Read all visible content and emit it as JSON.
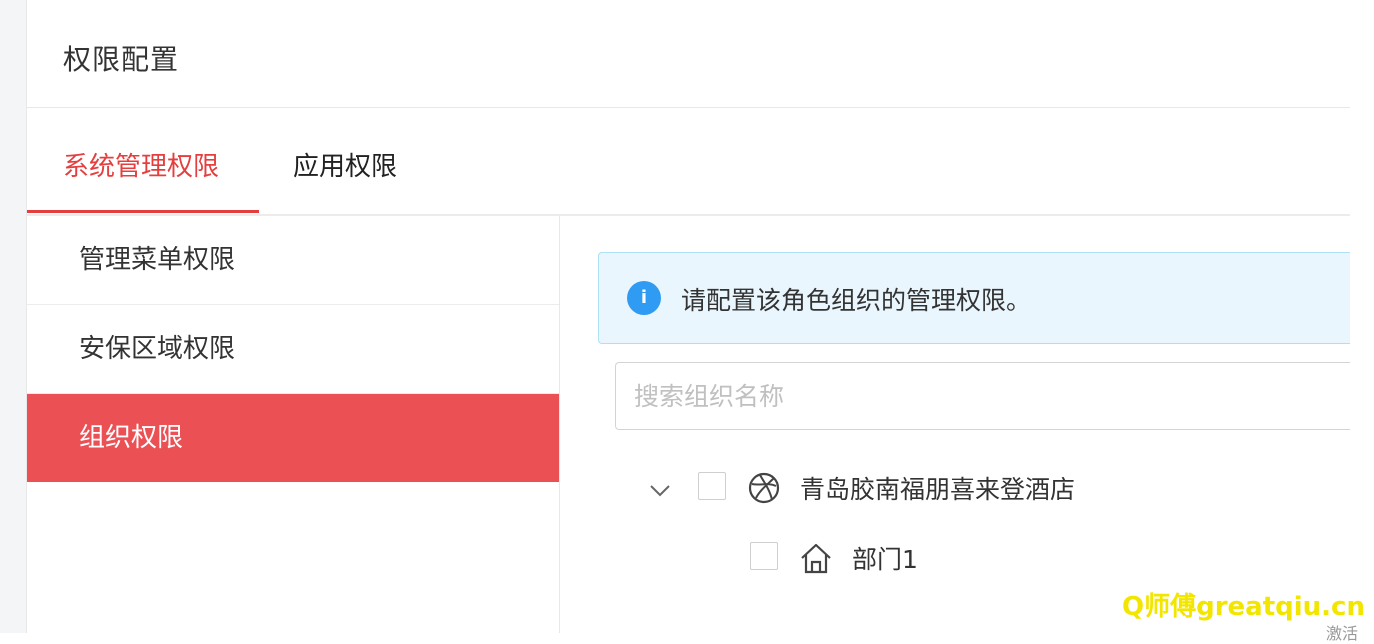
{
  "header": {
    "title": "权限配置"
  },
  "tabs": [
    {
      "label": "系统管理权限",
      "active": true
    },
    {
      "label": "应用权限",
      "active": false
    }
  ],
  "sidebar": {
    "items": [
      {
        "label": "管理菜单权限",
        "active": false
      },
      {
        "label": "安保区域权限",
        "active": false
      },
      {
        "label": "组织权限",
        "active": true
      }
    ]
  },
  "main": {
    "alert": {
      "icon": "info-icon",
      "text": "请配置该角色组织的管理权限。"
    },
    "search": {
      "placeholder": "搜索组织名称",
      "value": ""
    },
    "tree": {
      "root": {
        "label": "青岛胶南福朋喜来登酒店",
        "icon": "globe-icon",
        "expanded": true,
        "checked": false
      },
      "children": [
        {
          "label": "部门1",
          "icon": "home-icon",
          "checked": false
        }
      ]
    }
  },
  "watermark": {
    "text": "Q师傅greatqiu.cn"
  },
  "corner": {
    "text": "激活"
  },
  "colors": {
    "accent": "#e53e3e",
    "active_sidebar_bg": "#eb5055",
    "alert_bg": "#eaf6fd",
    "alert_border": "#aee0f6",
    "info_icon": "#2f9bf3"
  }
}
